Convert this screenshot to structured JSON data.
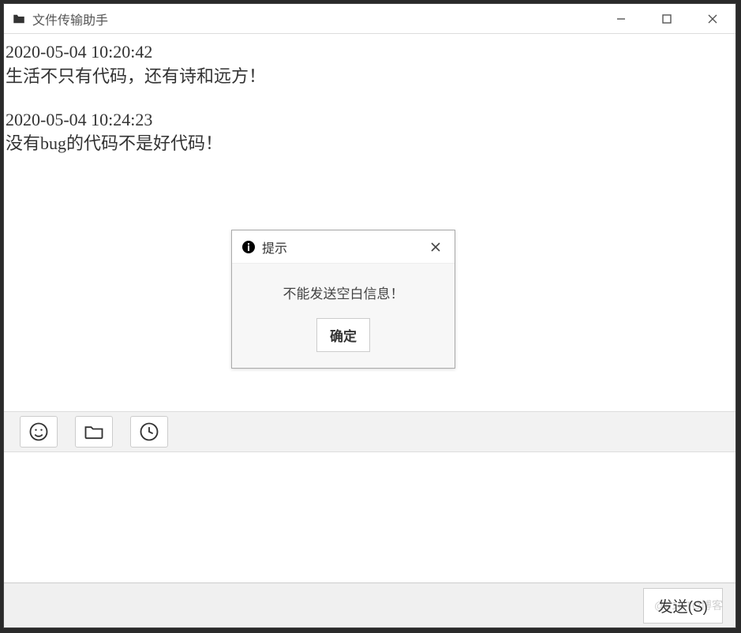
{
  "window": {
    "title": "文件传输助手"
  },
  "messages": [
    {
      "timestamp": "2020-05-04 10:20:42",
      "text": "生活不只有代码，还有诗和远方！"
    },
    {
      "timestamp": "2020-05-04 10:24:23",
      "text": "没有bug的代码不是好代码！"
    }
  ],
  "toolbar": {
    "emoji_tip": "emoji",
    "file_tip": "file",
    "history_tip": "history"
  },
  "send": {
    "label": "发送(S)"
  },
  "dialog": {
    "title": "提示",
    "message": "不能发送空白信息！",
    "ok_label": "确定"
  },
  "watermark": "@51CTO博客"
}
